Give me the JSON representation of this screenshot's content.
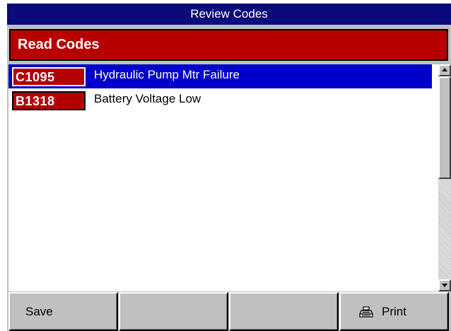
{
  "window": {
    "title": "Review Codes"
  },
  "section": {
    "header": "Read Codes"
  },
  "codes": [
    {
      "code": "C1095",
      "description": "Hydraulic Pump Mtr Failure",
      "selected": true
    },
    {
      "code": "B1318",
      "description": "Battery Voltage Low",
      "selected": false
    }
  ],
  "function_keys": [
    {
      "label": "Save",
      "icon": ""
    },
    {
      "label": "",
      "icon": ""
    },
    {
      "label": "",
      "icon": ""
    },
    {
      "label": "Print",
      "icon": "printer-icon"
    }
  ],
  "colors": {
    "title_bar": "#0a0a7a",
    "header_red": "#b70000",
    "selection_blue": "#0000cc",
    "panel_gray": "#c0c0c0"
  }
}
